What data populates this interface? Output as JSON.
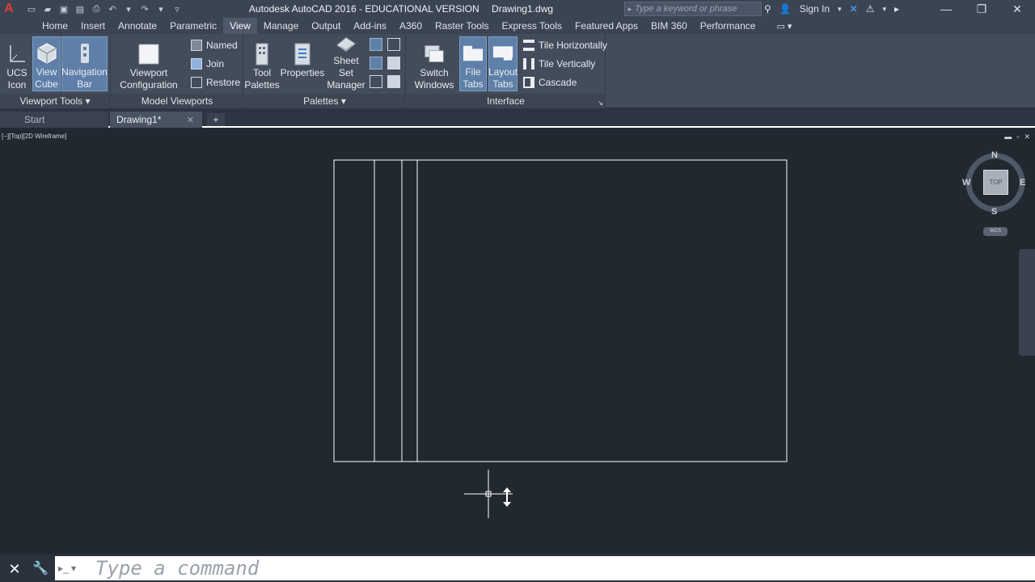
{
  "titlebar": {
    "app_title": "Autodesk AutoCAD 2016 - EDUCATIONAL VERSION",
    "document": "Drawing1.dwg",
    "search_placeholder": "Type a keyword or phrase",
    "sign_in": "Sign In"
  },
  "ribbon_tabs": [
    "Home",
    "Insert",
    "Annotate",
    "Parametric",
    "View",
    "Manage",
    "Output",
    "Add-ins",
    "A360",
    "Raster Tools",
    "Express Tools",
    "Featured Apps",
    "BIM 360",
    "Performance"
  ],
  "active_tab": "View",
  "panels": {
    "viewport_tools": {
      "title": "Viewport Tools ▾",
      "ucs_icon": [
        "UCS",
        "Icon"
      ],
      "view_cube": [
        "View",
        "Cube"
      ],
      "navigation_bar": [
        "Navigation",
        "Bar"
      ]
    },
    "model_viewports": {
      "title": "Model Viewports",
      "viewport_configuration": [
        "Viewport",
        "Configuration"
      ],
      "named": "Named",
      "join": "Join",
      "restore": "Restore"
    },
    "palettes": {
      "title": "Palettes ▾",
      "tool_palettes": [
        "Tool",
        "Palettes"
      ],
      "properties": "Properties",
      "sheet_set_manager": [
        "Sheet Set",
        "Manager"
      ]
    },
    "interface": {
      "title": "Interface",
      "switch_windows": [
        "Switch",
        "Windows"
      ],
      "file_tabs": [
        "File",
        "Tabs"
      ],
      "layout_tabs": [
        "Layout",
        "Tabs"
      ],
      "tile_horizontally": "Tile Horizontally",
      "tile_vertically": "Tile Vertically",
      "cascade": "Cascade"
    }
  },
  "file_tabs": {
    "start": "Start",
    "drawing": "Drawing1*",
    "new": "+"
  },
  "viewport": {
    "label": "[−][Top][2D Wireframe]",
    "controls": [
      "▬",
      "▫",
      "✕"
    ]
  },
  "viewcube": {
    "north": "N",
    "south": "S",
    "east": "E",
    "west": "W",
    "face": "TOP",
    "wcs": "WCS"
  },
  "command_line": {
    "placeholder": "Type a command"
  },
  "colors": {
    "canvas": "#212830",
    "ribbon": "#434c5b",
    "accent_active": "#5e7fa8",
    "geometry": "#ffffff"
  }
}
